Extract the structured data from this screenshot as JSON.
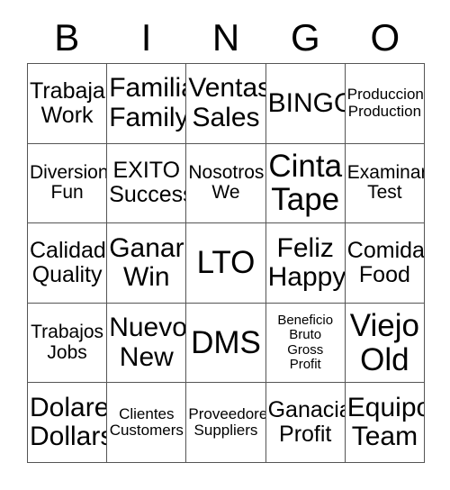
{
  "card": {
    "title": "BINGO",
    "header_letters": [
      "B",
      "I",
      "N",
      "G",
      "O"
    ],
    "border_color": "#555555",
    "background_color": "#ffffff",
    "text_color": "#000000",
    "rows": 5,
    "columns": 5,
    "cells": [
      [
        {
          "lines": [
            "Trabajar",
            "Work"
          ],
          "size": "lg"
        },
        {
          "lines": [
            "Familia",
            "Family"
          ],
          "size": "xl"
        },
        {
          "lines": [
            "Ventas",
            "Sales"
          ],
          "size": "xl"
        },
        {
          "lines": [
            "BINGO"
          ],
          "size": "xl"
        },
        {
          "lines": [
            "Produccion",
            "Production"
          ],
          "size": "sm"
        }
      ],
      [
        {
          "lines": [
            "Diversion",
            "Fun"
          ],
          "size": "md"
        },
        {
          "lines": [
            "EXITO",
            "Success"
          ],
          "size": "lg"
        },
        {
          "lines": [
            "Nosotros",
            "We"
          ],
          "size": "md"
        },
        {
          "lines": [
            "Cinta",
            "Tape"
          ],
          "size": "xxl"
        },
        {
          "lines": [
            "Examinar",
            "Test"
          ],
          "size": "md"
        }
      ],
      [
        {
          "lines": [
            "Calidad",
            "Quality"
          ],
          "size": "lg"
        },
        {
          "lines": [
            "Ganar",
            "Win"
          ],
          "size": "xl"
        },
        {
          "lines": [
            "LTO"
          ],
          "size": "xxl"
        },
        {
          "lines": [
            "Feliz",
            "Happy"
          ],
          "size": "xl"
        },
        {
          "lines": [
            "Comida",
            "Food"
          ],
          "size": "lg"
        }
      ],
      [
        {
          "lines": [
            "Trabajos",
            "Jobs"
          ],
          "size": "md"
        },
        {
          "lines": [
            "Nuevo",
            "New"
          ],
          "size": "xl"
        },
        {
          "lines": [
            "DMS"
          ],
          "size": "xxl"
        },
        {
          "lines": [
            "Beneficio",
            "Bruto",
            "Gross",
            "Profit"
          ],
          "size": "xs"
        },
        {
          "lines": [
            "Viejo",
            "Old"
          ],
          "size": "xxl"
        }
      ],
      [
        {
          "lines": [
            "Dolares",
            "Dollars"
          ],
          "size": "xl"
        },
        {
          "lines": [
            "Clientes",
            "Customers"
          ],
          "size": "sm"
        },
        {
          "lines": [
            "Proveedores",
            "Suppliers"
          ],
          "size": "sm"
        },
        {
          "lines": [
            "Ganacia",
            "Profit"
          ],
          "size": "lg"
        },
        {
          "lines": [
            "Equipo",
            "Team"
          ],
          "size": "xl"
        }
      ]
    ]
  }
}
